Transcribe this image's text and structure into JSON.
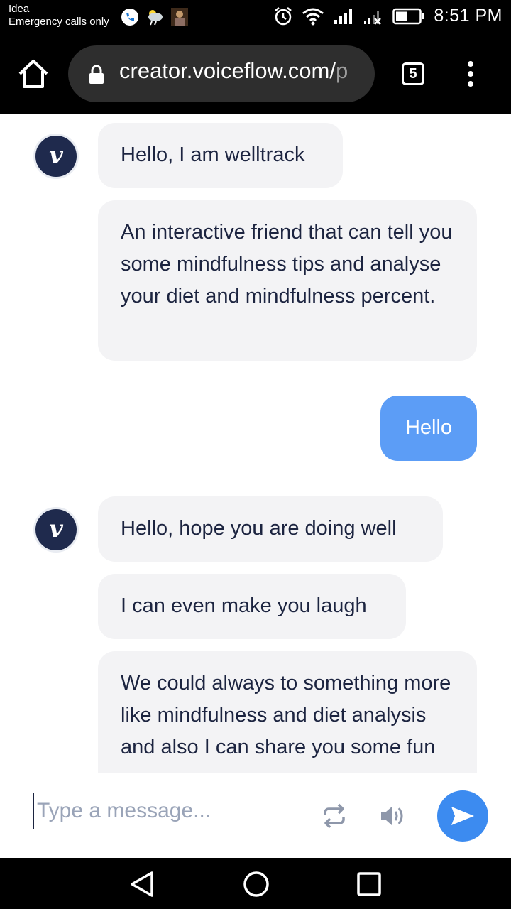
{
  "status_bar": {
    "carrier": "Idea",
    "network_note": "Emergency calls only",
    "time": "8:51 PM",
    "icons": [
      "phone-icon",
      "weather-icon",
      "photo-notification-icon",
      "alarm-icon",
      "wifi-icon",
      "signal-icon",
      "no-signal-icon",
      "battery-icon"
    ]
  },
  "browser": {
    "url_main": "creator.voiceflow.com/",
    "url_rest": "p",
    "tab_count": "5",
    "icons": [
      "home-icon",
      "lock-icon",
      "overflow-menu-icon"
    ]
  },
  "chat": {
    "avatar_letter": "v",
    "messages": [
      {
        "sender": "bot",
        "text": "Hello, I am welltrack"
      },
      {
        "sender": "bot",
        "text": "An interactive friend that can tell you some mindfulness tips and analyse your diet and mindfulness percent."
      },
      {
        "sender": "user",
        "text": "Hello"
      },
      {
        "sender": "bot",
        "text": "Hello, hope you are doing well"
      },
      {
        "sender": "bot",
        "text": "I can even make you laugh"
      },
      {
        "sender": "bot",
        "text": "We could always to something more like mindfulness and diet analysis and also I can share you some fun"
      }
    ]
  },
  "composer": {
    "placeholder": "Type a message...",
    "icons": [
      "repeat-icon",
      "speaker-icon",
      "send-icon"
    ]
  },
  "nav_bar": {
    "icons": [
      "back-icon",
      "home-circle-icon",
      "recents-icon"
    ]
  },
  "colors": {
    "bot_bubble": "#f3f3f5",
    "user_bubble": "#5c9df6",
    "avatar": "#1f2a4d",
    "send_button": "#3c8bf0",
    "text_dark": "#1c2440"
  }
}
